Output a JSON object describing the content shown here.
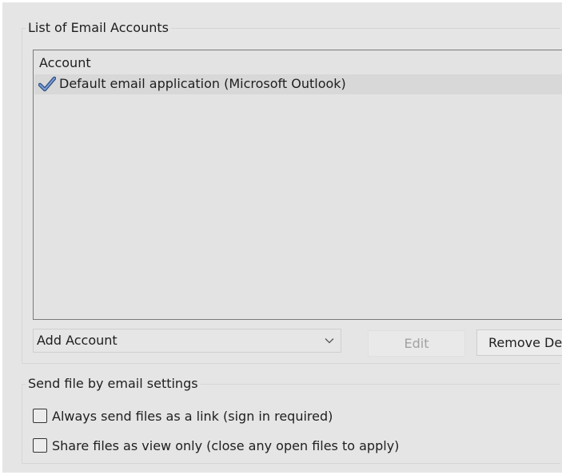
{
  "email_accounts": {
    "title": "List of Email Accounts",
    "column_header": "Account",
    "items": [
      {
        "label": "Default email application (Microsoft Outlook)",
        "is_default": true,
        "icon": "checkmark-icon"
      }
    ],
    "add_account": {
      "selected": "Add Account"
    },
    "buttons": {
      "edit": "Edit",
      "remove_default": "Remove Def"
    }
  },
  "send_settings": {
    "title": "Send file by email settings",
    "options": [
      {
        "label": "Always send files as a link (sign in required)",
        "checked": false
      },
      {
        "label": "Share files as view only (close any open files to apply)",
        "checked": false
      }
    ]
  },
  "colors": {
    "dialog_bg": "#e5e5e5",
    "list_bg": "#e3e3e3",
    "selected_row": "#d8d8d8",
    "check_icon": "#5276b4",
    "disabled_text": "#a2a2a2"
  }
}
